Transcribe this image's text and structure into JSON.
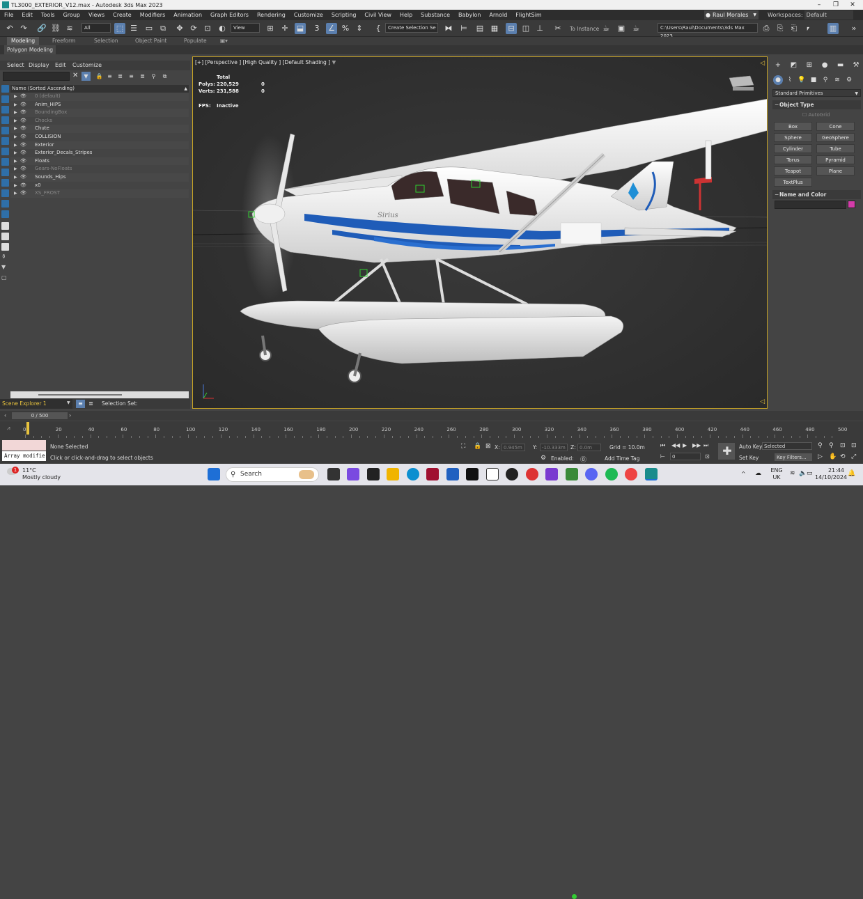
{
  "window": {
    "title": "TL3000_EXTERIOR_V12.max - Autodesk 3ds Max 2023",
    "minimize": "–",
    "maximize": "❐",
    "close": "✕"
  },
  "menu": [
    "File",
    "Edit",
    "Tools",
    "Group",
    "Views",
    "Create",
    "Modifiers",
    "Animation",
    "Graph Editors",
    "Rendering",
    "Customize",
    "Scripting",
    "Civil View",
    "Help",
    "Substance",
    "Babylon",
    "Arnold",
    "FlightSim"
  ],
  "user": "Raul Morales",
  "workspaces": {
    "label": "Workspaces:",
    "value": "Default"
  },
  "toolbar": {
    "selection_filter": "All",
    "view_dropdown": "View",
    "named_selection": "Create Selection Se",
    "to_instance": "To Instance",
    "path": "C:\\Users\\Raul\\Documents\\3ds Max 2023"
  },
  "ribbon": {
    "tabs": [
      "Modeling",
      "Freeform",
      "Selection",
      "Object Paint",
      "Populate"
    ],
    "active": "Modeling",
    "sub": "Polygon Modeling"
  },
  "scene_explorer": {
    "menu": [
      "Select",
      "Display",
      "Edit",
      "Customize"
    ],
    "column_header": "Name (Sorted Ascending)",
    "items": [
      {
        "name": "0 (default)",
        "dim": true
      },
      {
        "name": "Anim_HIPS",
        "dim": false
      },
      {
        "name": "BoundingBox",
        "dim": true
      },
      {
        "name": "Chocks",
        "dim": true
      },
      {
        "name": "Chute",
        "dim": false
      },
      {
        "name": "COLLISION",
        "dim": false
      },
      {
        "name": "Exterior",
        "dim": false
      },
      {
        "name": "Exterior_Decals_Stripes",
        "dim": false
      },
      {
        "name": "Floats",
        "dim": false
      },
      {
        "name": "Gears-NoFloats",
        "dim": true
      },
      {
        "name": "Sounds_Hips",
        "dim": false
      },
      {
        "name": "x0",
        "dim": false
      },
      {
        "name": "XS_FROST",
        "dim": true
      }
    ],
    "tab_name": "Scene Explorer 1",
    "selection_set_label": "Selection Set:"
  },
  "viewport": {
    "label": "[+] [Perspective ] [High Quality ] [Default Shading ]",
    "stats": {
      "header": "Total",
      "polys_label": "Polys:",
      "polys_total": "220,529",
      "polys_sel": "0",
      "verts_label": "Verts:",
      "verts_total": "231,588",
      "verts_sel": "0",
      "fps_label": "FPS:",
      "fps_value": "Inactive"
    },
    "aircraft_text": "Sirius"
  },
  "command_panel": {
    "category": "Standard Primitives",
    "object_type_title": "Object Type",
    "autogrid": "AutoGrid",
    "buttons": [
      "Box",
      "Cone",
      "Sphere",
      "GeoSphere",
      "Cylinder",
      "Tube",
      "Torus",
      "Pyramid",
      "Teapot",
      "Plane",
      "TextPlus"
    ],
    "name_color_title": "Name and Color",
    "swatch_color": "#d43caa"
  },
  "timeline": {
    "frame_display": "0 / 500",
    "ticks": [
      "0",
      "20",
      "40",
      "60",
      "80",
      "100",
      "120",
      "140",
      "160",
      "180",
      "200",
      "220",
      "240",
      "260",
      "280",
      "300",
      "320",
      "340",
      "360",
      "380",
      "400",
      "420",
      "440",
      "460",
      "480",
      "500"
    ]
  },
  "status": {
    "maxscript_text": "Array modifie",
    "line1": "None Selected",
    "line2": "Click or click-and-drag to select objects",
    "x_label": "X:",
    "x_value": "0.945m",
    "y_label": "Y:",
    "y_value": "-10.333m",
    "z_label": "Z:",
    "z_value": "0.0m",
    "grid": "Grid = 10.0m",
    "enabled": "Enabled:",
    "add_time_tag": "Add Time Tag",
    "auto_key": "Auto Key",
    "set_key": "Set Key",
    "selected": "Selected",
    "key_filters": "Key Filters...",
    "frame_field": "0"
  },
  "taskbar": {
    "temp": "11°C",
    "weather": "Mostly cloudy",
    "search": "Search",
    "lang1": "ENG",
    "lang2": "UK",
    "time": "21:44",
    "date": "14/10/2024"
  }
}
